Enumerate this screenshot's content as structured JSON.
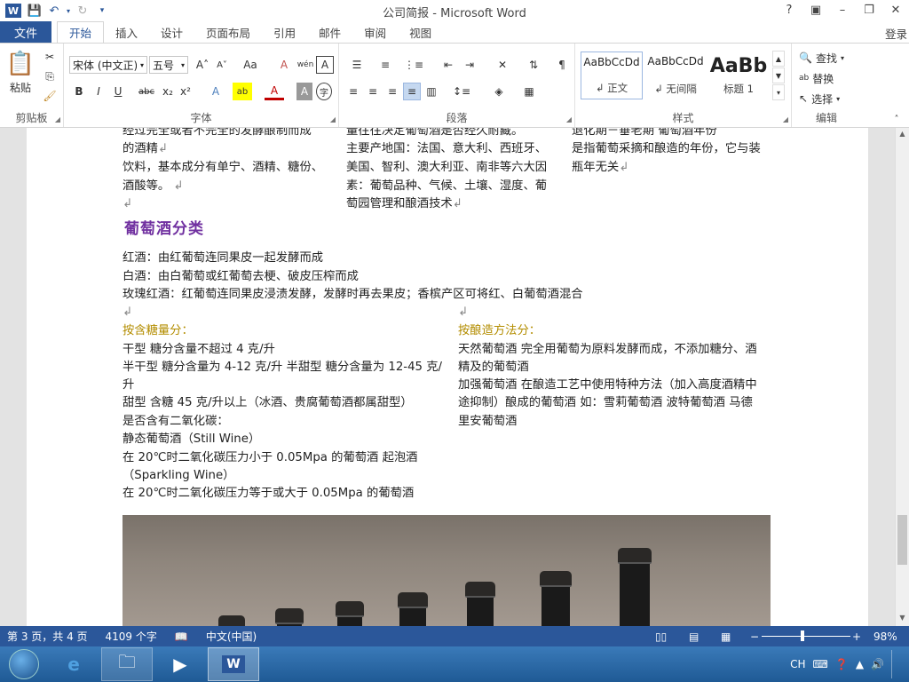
{
  "window": {
    "title": "公司简报 - Microsoft Word",
    "help": "?",
    "login": "登录"
  },
  "tabs": {
    "file": "文件",
    "items": [
      "开始",
      "插入",
      "设计",
      "页面布局",
      "引用",
      "邮件",
      "审阅",
      "视图"
    ]
  },
  "ribbon": {
    "clipboard": {
      "label": "剪贴板",
      "paste": "粘贴"
    },
    "font": {
      "label": "字体",
      "family": "宋体 (中文正)",
      "size": "五号",
      "bold": "B",
      "italic": "I",
      "underline": "U",
      "strike": "abc",
      "sub": "x₂",
      "sup": "x²",
      "grow": "A˄",
      "shrink": "A˅",
      "case": "Aa",
      "clear": "A",
      "phonetic": "wén",
      "border": "A",
      "effects": "A",
      "highlight": "ab",
      "color": "A",
      "shade": "A",
      "enclose": "字"
    },
    "paragraph": {
      "label": "段落"
    },
    "styles": {
      "label": "样式",
      "items": [
        {
          "preview": "AaBbCcDd",
          "name": "↲ 正文"
        },
        {
          "preview": "AaBbCcDd",
          "name": "↲ 无间隔"
        },
        {
          "preview": "AaBb",
          "name": "标题 1"
        }
      ]
    },
    "editing": {
      "label": "编辑",
      "find": "查找",
      "replace": "替换",
      "select": "选择"
    }
  },
  "doc": {
    "col1": [
      "经过完全或者不完全的发酵酿制而成",
      "的酒精",
      "饮料，基本成分有单宁、酒精、糖份、",
      "酒酸等。"
    ],
    "col2": [
      "量往往决定葡萄酒是否经久耐藏。",
      "主要产地国：法国、意大利、西班牙、",
      "美国、智利、澳大利亚、南非等六大因",
      "素：葡萄品种、气候、土壤、湿度、葡",
      "萄园管理和酿酒技术"
    ],
    "col3": [
      "退化期－垂老期 葡萄酒年份",
      "是指葡萄采摘和酿造的年份，它与装",
      "瓶年无关"
    ],
    "heading": "葡萄酒分类",
    "types": [
      "红酒：由红葡萄连同果皮一起发酵而成",
      "白酒：由白葡萄或红葡萄去梗、破皮压榨而成",
      "玫瑰红酒：红葡萄连同果皮浸渍发酵，发酵时再去果皮；香槟产区可将红、白葡萄酒混合"
    ],
    "left_head": "按含糖量分：",
    "left": [
      "干型  糖分含量不超过 4 克/升",
      "半干型 糖分含量为 4-12 克/升 半甜型 糖分含量为 12-45 克/",
      "升",
      "甜型  含糖 45 克/升以上（冰酒、贵腐葡萄酒都属甜型）",
      "是否含有二氧化碳：",
      "静态葡萄酒（Still Wine）",
      "在  20℃时二氧化碳压力小于  0.05Mpa  的葡萄酒 起泡酒",
      "（Sparkling Wine）",
      "在 20℃时二氧化碳压力等于或大于 0.05Mpa 的葡萄酒"
    ],
    "right_head": "按酿造方法分：",
    "right": [
      "天然葡萄酒  完全用葡萄为原料发酵而成，不添加糖分、酒",
      "精及的葡萄酒",
      "加强葡萄酒  在酿造工艺中使用特种方法（加入高度酒精中",
      "途抑制）酿成的葡萄酒 如：雪莉葡萄酒  波特葡萄酒  马德",
      "里安葡萄酒"
    ]
  },
  "status": {
    "page": "第 3 页，共 4 页",
    "words": "4109 个字",
    "lang": "中文(中国)",
    "zoom": "98%",
    "zoom_minus": "−",
    "zoom_plus": "+"
  },
  "tray": {
    "ime": "CH"
  }
}
